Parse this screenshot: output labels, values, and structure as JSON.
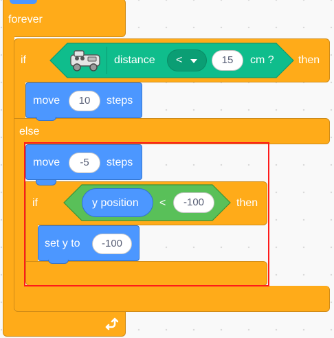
{
  "blocks": {
    "forever_label": "forever",
    "if1": {
      "if_label": "if",
      "sensor_icon": "robot-car-sensor-icon",
      "distance_label": "distance",
      "operator": "<",
      "value": "15",
      "unit_label": "cm ?",
      "then_label": "then"
    },
    "move1": {
      "label": "move",
      "value": "10",
      "suffix": "steps"
    },
    "else_label": "else",
    "move2": {
      "label": "move",
      "value": "-5",
      "suffix": "steps"
    },
    "if2": {
      "if_label": "if",
      "reporter": "y position",
      "operator": "<",
      "value": "-100",
      "then_label": "then"
    },
    "sety": {
      "label": "set y to",
      "value": "-100"
    }
  },
  "colors": {
    "control": "#ffab19",
    "motion": "#4c97ff",
    "extension_sensor": "#0fbd8c",
    "operators": "#59c059",
    "highlight": "#ff1a1a"
  }
}
